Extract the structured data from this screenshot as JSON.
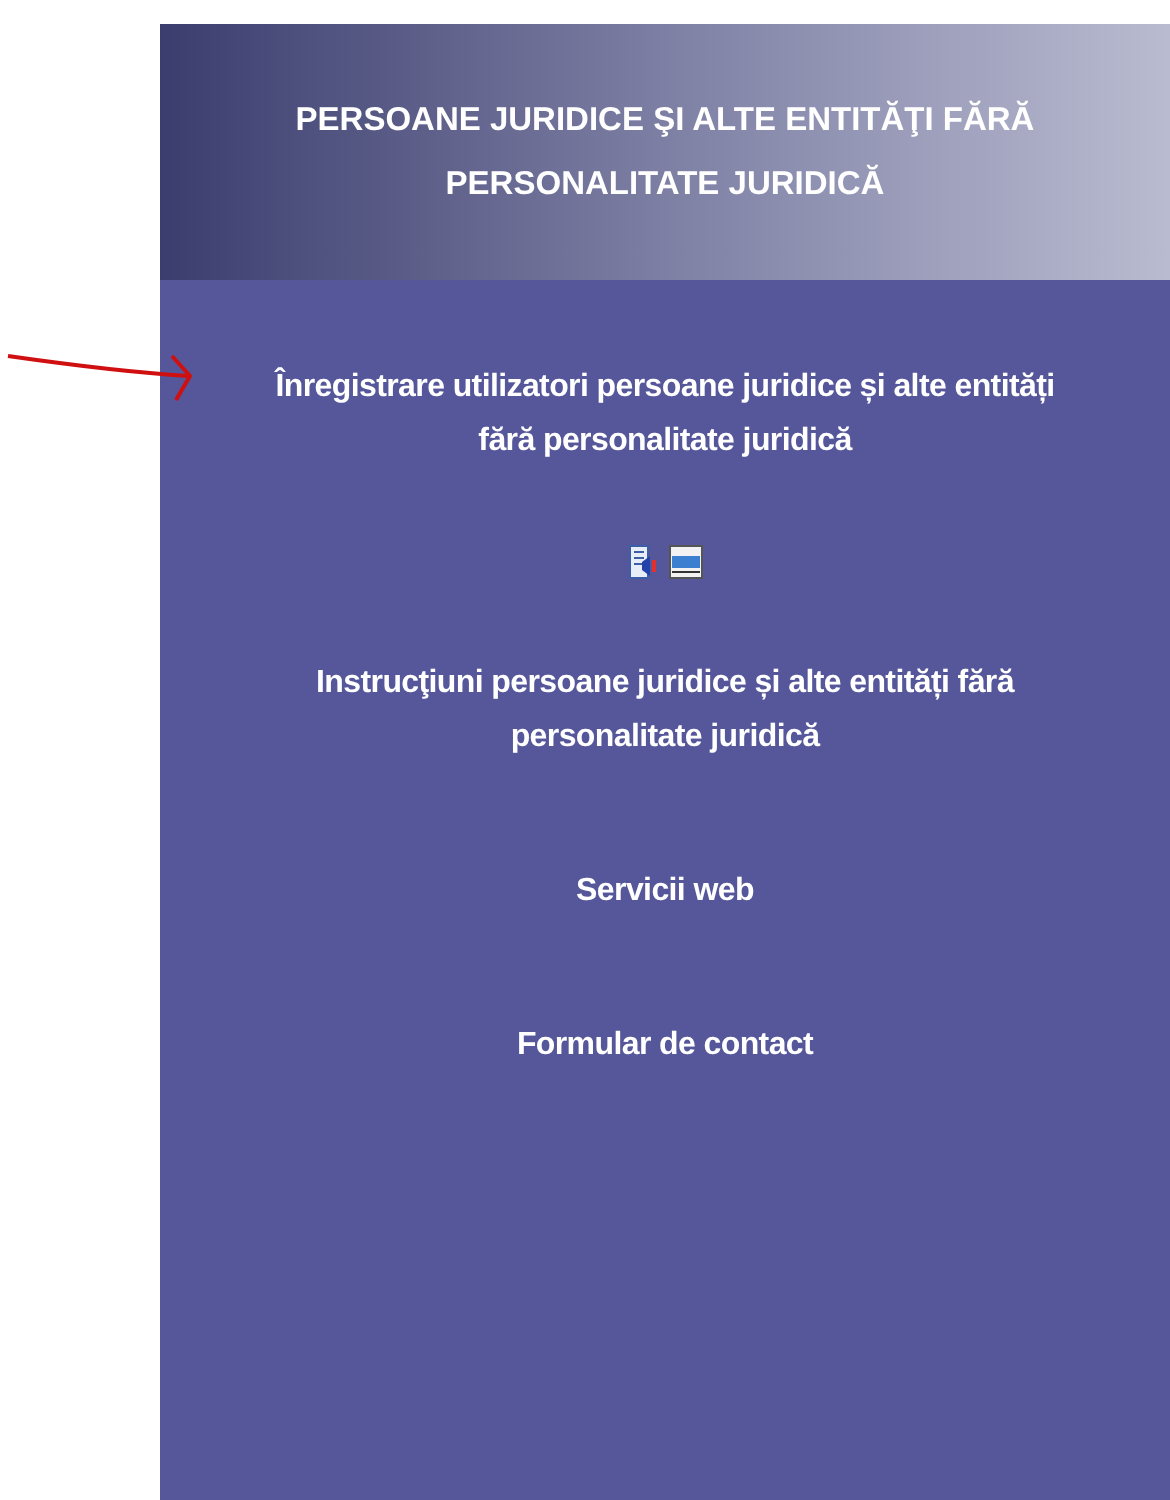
{
  "header": {
    "title": "PERSOANE JURIDICE ŞI ALTE ENTITĂŢI FĂRĂ PERSONALITATE JURIDICĂ"
  },
  "links": [
    {
      "kind": "link",
      "label": "Înregistrare utilizatori persoane juridice și alte entități fără personalitate juridică"
    },
    {
      "kind": "icons"
    },
    {
      "kind": "link",
      "label": "Instrucţiuni persoane juridice și alte entități fără personalitate juridică"
    },
    {
      "kind": "link",
      "label": "Servicii web"
    },
    {
      "kind": "link",
      "label": "Formular de contact"
    }
  ],
  "annotation": {
    "kind": "arrow"
  }
}
